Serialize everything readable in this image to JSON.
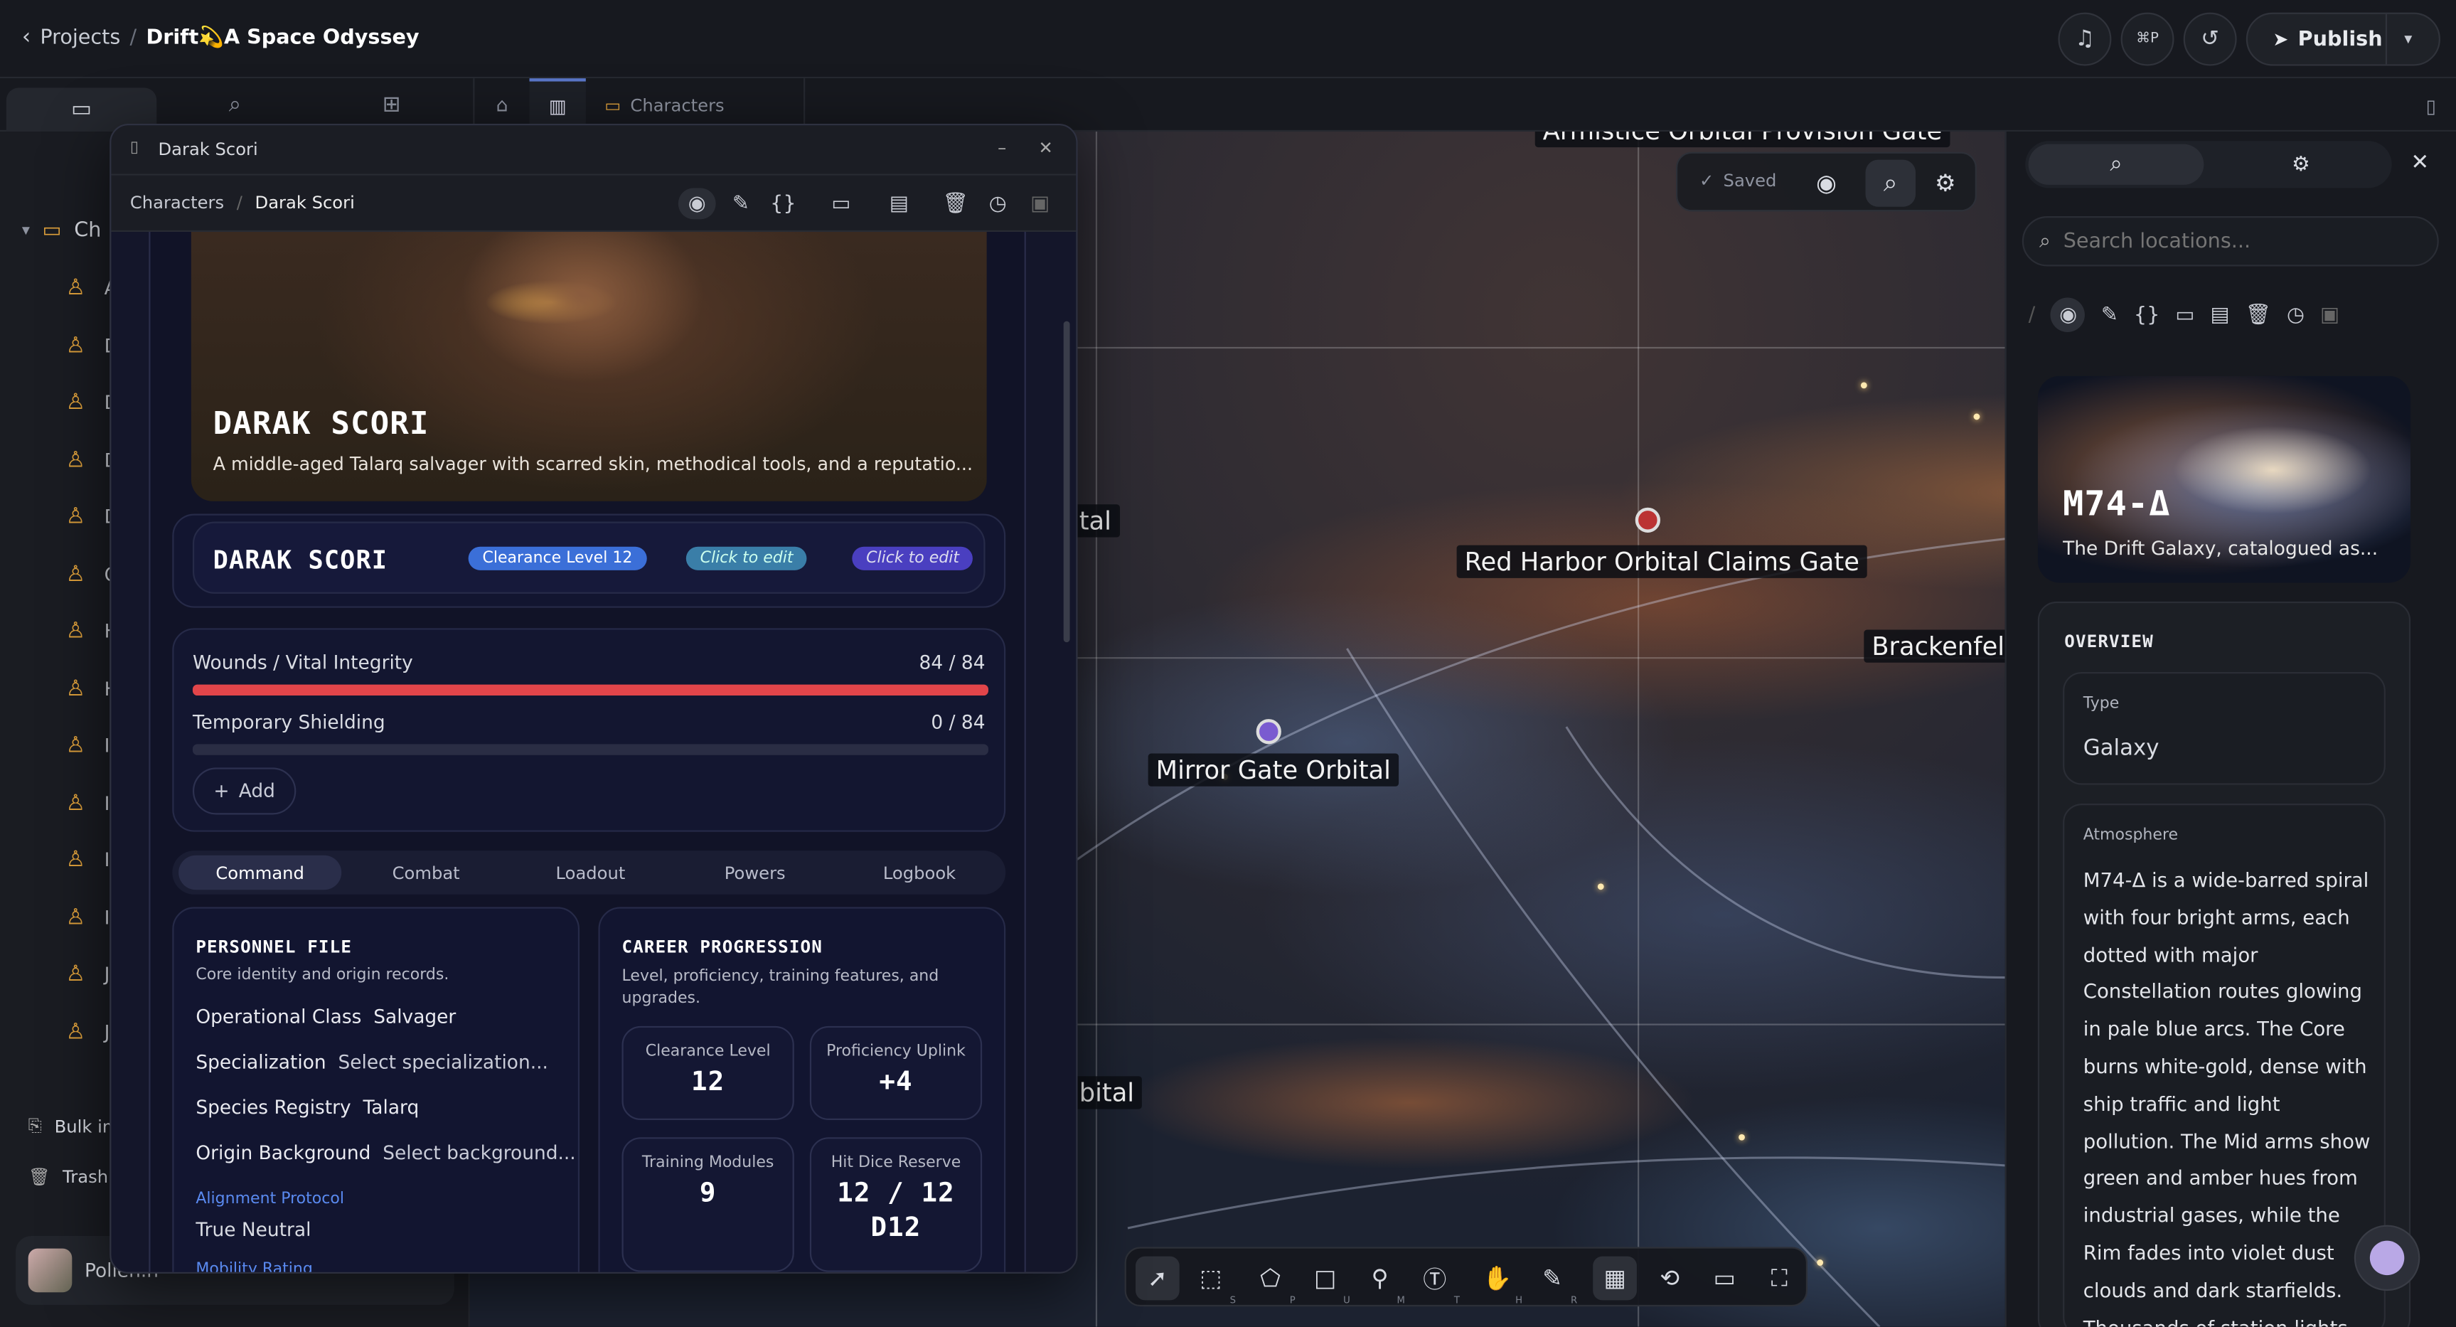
{
  "topbar": {
    "back_label": "Projects",
    "project_name": "Drift💫A Space Odyssey",
    "shortcut": "⌘P",
    "publish_label": "Publish"
  },
  "tabs": {
    "characters_tab": "Characters"
  },
  "sidebar": {
    "folder_label": "Ch",
    "letters": [
      "A",
      "D",
      "D",
      "D",
      "D",
      "C",
      "H",
      "H",
      "II",
      "II",
      "In",
      "Is",
      "J",
      "J"
    ],
    "bulk_label": "Bulk im",
    "trash_label": "Trash",
    "user_name": "Pollen.n"
  },
  "map": {
    "labels": {
      "top_cut": "Armistice Orbital Provision Gate",
      "red_harbor": "Red Harbor Orbital Claims Gate",
      "brackenfeld": "Brackenfeld",
      "mirror_gate": "Mirror Gate Orbital",
      "left_tal": "tal",
      "left_bital": "bital"
    },
    "saved_label": "Saved"
  },
  "bottom_tools": {
    "shortcuts": [
      "S",
      "P",
      "U",
      "M",
      "T",
      "H",
      "R"
    ]
  },
  "right": {
    "search_placeholder": "Search locations...",
    "hero_title": "M74-Δ",
    "hero_subtitle": "The Drift Galaxy, catalogued as...",
    "overview_title": "OVERVIEW",
    "type_label": "Type",
    "type_value": "Galaxy",
    "atmosphere_label": "Atmosphere",
    "atmosphere_text": "M74-Δ is a wide-barred spiral with four bright arms, each dotted with major Constellation routes glowing in pale blue arcs. The Core burns white-gold, dense with ship traffic and light pollution. The Mid arms show green and amber hues from industrial gases, while the Rim fades into violet dust clouds and dark starfields. Thousands of station lights glimmer"
  },
  "window": {
    "title": "Darak Scori",
    "crumb_parent": "Characters",
    "crumb_current": "Darak Scori"
  },
  "character": {
    "hero_name": "DARAK SCORI",
    "hero_desc": "A middle-aged Talarq salvager with scarred skin, methodical tools, and a reputatio...",
    "name_bar": "DARAK SCORI",
    "clearance_badge": "Clearance Level 12",
    "click_edit_1": "Click to edit",
    "click_edit_2": "Click to edit",
    "wounds_label": "Wounds / Vital Integrity",
    "wounds_value": "84 / 84",
    "wounds_fraction": 1,
    "shield_label": "Temporary Shielding",
    "shield_value": "0 / 84",
    "shield_fraction": 0,
    "add_label": "Add",
    "tabs": [
      "Command",
      "Combat",
      "Loadout",
      "Powers",
      "Logbook"
    ],
    "personnel": {
      "title": "PERSONNEL FILE",
      "subtitle": "Core identity and origin records.",
      "rows": [
        {
          "k": "Operational Class",
          "v": "Salvager"
        },
        {
          "k": "Specialization",
          "v": "Select specialization..."
        },
        {
          "k": "Species Registry",
          "v": "Talarq"
        },
        {
          "k": "Origin Background",
          "v": "Select background..."
        }
      ],
      "alignment_label": "Alignment Protocol",
      "alignment_value": "True Neutral",
      "mobility_label": "Mobility Rating"
    },
    "career": {
      "title": "CAREER PROGRESSION",
      "subtitle": "Level, proficiency, training features, and upgrades.",
      "stats": [
        {
          "label": "Clearance Level",
          "value": "12"
        },
        {
          "label": "Proficiency Uplink",
          "value": "+4"
        },
        {
          "label": "Training Modules",
          "value": "9"
        },
        {
          "label": "Hit Dice Reserve",
          "value": "12 / 12"
        }
      ],
      "hit_die": "D12"
    }
  },
  "colors": {
    "accent_blue": "#3b6fd8",
    "health_red": "#e2454a",
    "folder_orange": "#e2a33c"
  }
}
